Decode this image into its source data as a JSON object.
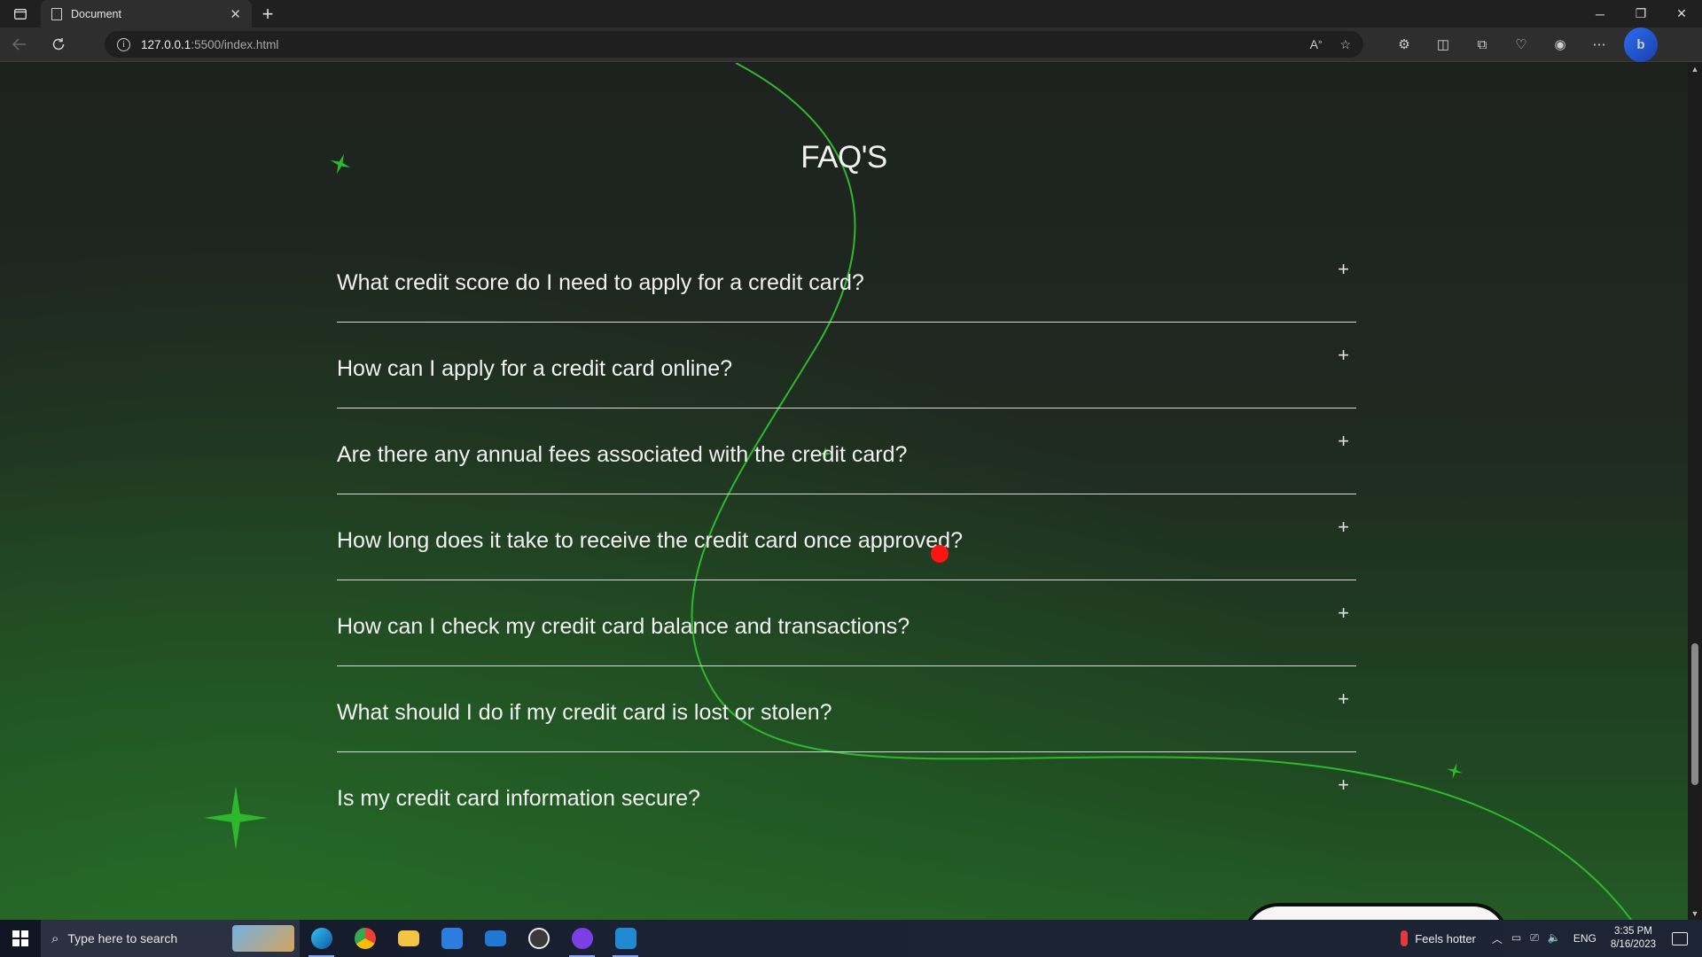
{
  "browser": {
    "tab_title": "Document",
    "url_host": "127.0.0.1",
    "url_rest": ":5500/index.html",
    "new_tab_symbol": "+",
    "close_tab_symbol": "✕",
    "window_minimize": "─",
    "window_restore": "❐",
    "window_close": "✕"
  },
  "page": {
    "heading": "FAQ'S",
    "faqs": [
      {
        "question": "What credit score do I need to apply for a credit card?",
        "toggle": "+"
      },
      {
        "question": "How can I apply for a credit card online?",
        "toggle": "+"
      },
      {
        "question": "Are there any annual fees associated with the credit card?",
        "toggle": "+"
      },
      {
        "question": "How long does it take to receive the credit card once approved?",
        "toggle": "+"
      },
      {
        "question": "How can I check my credit card balance and transactions?",
        "toggle": "+"
      },
      {
        "question": "What should I do if my credit card is lost or stolen?",
        "toggle": "+"
      },
      {
        "question": "Is my credit card information secure?",
        "toggle": "+"
      }
    ],
    "hovered_item_index": 3,
    "accent_color": "#2db82d"
  },
  "taskbar": {
    "search_placeholder": "Type here to search",
    "weather_text": "Feels hotter",
    "language": "ENG",
    "time": "3:35 PM",
    "date": "8/16/2023",
    "apps": [
      "edge-icon",
      "chrome-icon",
      "file-explorer-icon",
      "store-icon",
      "mail-icon",
      "media-player-icon",
      "github-desktop-icon",
      "vscode-icon"
    ]
  }
}
